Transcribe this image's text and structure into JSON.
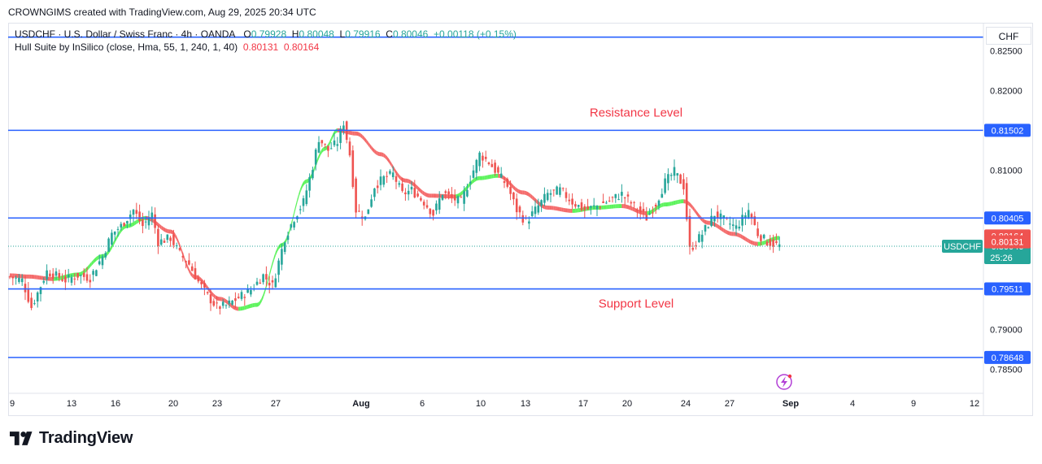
{
  "header": {
    "credit": "CROWNGIMS created with TradingView.com, Aug 29, 2025 20:34 UTC"
  },
  "legend": {
    "symbol": "USDCHF · U.S. Dollar / Swiss Franc · 4h · OANDA",
    "o_label": "O",
    "o_value": "0.79928",
    "h_label": "H",
    "h_value": "0.80048",
    "l_label": "L",
    "l_value": "0.79916",
    "c_label": "C",
    "c_value": "0.80046",
    "change": "+0.00118 (+0.15%)",
    "indicator": "Hull Suite by InSilico (close, Hma, 55, 1, 240, 1, 40)",
    "ind_value1": "0.80131",
    "ind_value2": "0.80164"
  },
  "currency": "CHF",
  "footer": {
    "brand": "TradingView"
  },
  "colors": {
    "up": "#26a69a",
    "down": "#ef5350",
    "level": "#2962ff",
    "hull_up": "#5cf35c",
    "hull_down": "#f46a6a",
    "annotation": "#f23645",
    "price_tag": "#26a69a"
  },
  "chart_data": {
    "type": "candlestick",
    "title": "",
    "timeframe": "4h",
    "y_range": [
      0.782,
      0.8285
    ],
    "x_ticks": [
      "9",
      "13",
      "16",
      "20",
      "23",
      "27",
      "Aug",
      "6",
      "10",
      "13",
      "17",
      "20",
      "24",
      "27",
      "Sep",
      "4",
      "9",
      "12"
    ],
    "y_ticks": [
      "0.82500",
      "0.82000",
      "0.81000",
      "0.79000",
      "0.78500"
    ],
    "levels": [
      {
        "price": 0.815,
        "label": "0.81502",
        "annotation": "Resistance Level"
      },
      {
        "price": 0.804,
        "label": "0.80405",
        "annotation": ""
      },
      {
        "price": 0.7951,
        "label": "0.79511",
        "annotation": "Support Level"
      },
      {
        "price": 0.7865,
        "label": "0.78648",
        "annotation": ""
      },
      {
        "price": 0.8267,
        "label": "",
        "annotation": ""
      }
    ],
    "current_price": {
      "symbol": "USDCHF",
      "price": 0.80046,
      "label": "0.80046",
      "countdown": "25:26"
    },
    "indicator_tags": [
      {
        "price": 0.80164,
        "label": "0.80164"
      },
      {
        "price": 0.80131,
        "label": "0.80131"
      }
    ],
    "hull_band": [
      {
        "i": 0,
        "a": 0.797,
        "b": 0.7966
      },
      {
        "i": 6,
        "a": 0.7968,
        "b": 0.7965
      },
      {
        "i": 14,
        "a": 0.7965,
        "b": 0.7962
      },
      {
        "i": 22,
        "a": 0.7968,
        "b": 0.797
      },
      {
        "i": 30,
        "a": 0.799,
        "b": 0.7994
      },
      {
        "i": 38,
        "a": 0.8028,
        "b": 0.8032
      },
      {
        "i": 44,
        "a": 0.804,
        "b": 0.804
      },
      {
        "i": 52,
        "a": 0.802,
        "b": 0.8026
      },
      {
        "i": 60,
        "a": 0.7962,
        "b": 0.797
      },
      {
        "i": 68,
        "a": 0.7935,
        "b": 0.7942
      },
      {
        "i": 74,
        "a": 0.7925,
        "b": 0.7927
      },
      {
        "i": 80,
        "a": 0.7932,
        "b": 0.793
      },
      {
        "i": 88,
        "a": 0.801,
        "b": 0.8002
      },
      {
        "i": 96,
        "a": 0.809,
        "b": 0.8082
      },
      {
        "i": 102,
        "a": 0.813,
        "b": 0.8124
      },
      {
        "i": 106,
        "a": 0.8154,
        "b": 0.8146
      },
      {
        "i": 112,
        "a": 0.8142,
        "b": 0.815
      },
      {
        "i": 120,
        "a": 0.8115,
        "b": 0.8125
      },
      {
        "i": 128,
        "a": 0.8082,
        "b": 0.8092
      },
      {
        "i": 136,
        "a": 0.8065,
        "b": 0.8071
      },
      {
        "i": 144,
        "a": 0.8068,
        "b": 0.8066
      },
      {
        "i": 152,
        "a": 0.8092,
        "b": 0.8088
      },
      {
        "i": 158,
        "a": 0.809,
        "b": 0.8096
      },
      {
        "i": 166,
        "a": 0.8068,
        "b": 0.8076
      },
      {
        "i": 174,
        "a": 0.805,
        "b": 0.8056
      },
      {
        "i": 182,
        "a": 0.8048,
        "b": 0.805
      },
      {
        "i": 190,
        "a": 0.8055,
        "b": 0.8051
      },
      {
        "i": 198,
        "a": 0.8052,
        "b": 0.8058
      },
      {
        "i": 206,
        "a": 0.8044,
        "b": 0.8048
      },
      {
        "i": 212,
        "a": 0.806,
        "b": 0.8054
      },
      {
        "i": 218,
        "a": 0.8058,
        "b": 0.8064
      },
      {
        "i": 226,
        "a": 0.803,
        "b": 0.8038
      },
      {
        "i": 234,
        "a": 0.8018,
        "b": 0.8022
      },
      {
        "i": 242,
        "a": 0.8005,
        "b": 0.801
      },
      {
        "i": 249,
        "a": 0.8012,
        "b": 0.8018
      }
    ],
    "candle_anchors": [
      [
        0,
        0.7966
      ],
      [
        4,
        0.7962
      ],
      [
        7,
        0.7928
      ],
      [
        12,
        0.7973
      ],
      [
        18,
        0.7962
      ],
      [
        22,
        0.7968
      ],
      [
        26,
        0.7965
      ],
      [
        30,
        0.7992
      ],
      [
        33,
        0.802
      ],
      [
        36,
        0.803
      ],
      [
        40,
        0.805
      ],
      [
        43,
        0.803
      ],
      [
        46,
        0.8045
      ],
      [
        48,
        0.801
      ],
      [
        52,
        0.8015
      ],
      [
        55,
        0.7995
      ],
      [
        58,
        0.7982
      ],
      [
        61,
        0.796
      ],
      [
        64,
        0.7942
      ],
      [
        67,
        0.7928
      ],
      [
        70,
        0.793
      ],
      [
        74,
        0.794
      ],
      [
        78,
        0.795
      ],
      [
        82,
        0.7968
      ],
      [
        85,
        0.7955
      ],
      [
        89,
        0.8015
      ],
      [
        92,
        0.804
      ],
      [
        95,
        0.806
      ],
      [
        98,
        0.8105
      ],
      [
        100,
        0.814
      ],
      [
        103,
        0.8125
      ],
      [
        106,
        0.8135
      ],
      [
        108,
        0.816
      ],
      [
        110,
        0.812
      ],
      [
        112,
        0.805
      ],
      [
        115,
        0.804
      ],
      [
        118,
        0.808
      ],
      [
        121,
        0.809
      ],
      [
        124,
        0.8095
      ],
      [
        127,
        0.807
      ],
      [
        130,
        0.8075
      ],
      [
        134,
        0.806
      ],
      [
        137,
        0.8045
      ],
      [
        140,
        0.8072
      ],
      [
        143,
        0.8065
      ],
      [
        146,
        0.806
      ],
      [
        149,
        0.809
      ],
      [
        152,
        0.812
      ],
      [
        155,
        0.811
      ],
      [
        158,
        0.8095
      ],
      [
        161,
        0.808
      ],
      [
        164,
        0.805
      ],
      [
        167,
        0.8035
      ],
      [
        170,
        0.805
      ],
      [
        174,
        0.807
      ],
      [
        178,
        0.8075
      ],
      [
        182,
        0.806
      ],
      [
        186,
        0.805
      ],
      [
        190,
        0.8055
      ],
      [
        194,
        0.8062
      ],
      [
        198,
        0.807
      ],
      [
        202,
        0.8055
      ],
      [
        206,
        0.804
      ],
      [
        209,
        0.8058
      ],
      [
        212,
        0.8085
      ],
      [
        215,
        0.8098
      ],
      [
        218,
        0.808
      ],
      [
        220,
        0.8
      ],
      [
        224,
        0.802
      ],
      [
        228,
        0.8045
      ],
      [
        232,
        0.8035
      ],
      [
        235,
        0.8028
      ],
      [
        239,
        0.805
      ],
      [
        242,
        0.802
      ],
      [
        245,
        0.801
      ],
      [
        249,
        0.8005
      ]
    ]
  }
}
